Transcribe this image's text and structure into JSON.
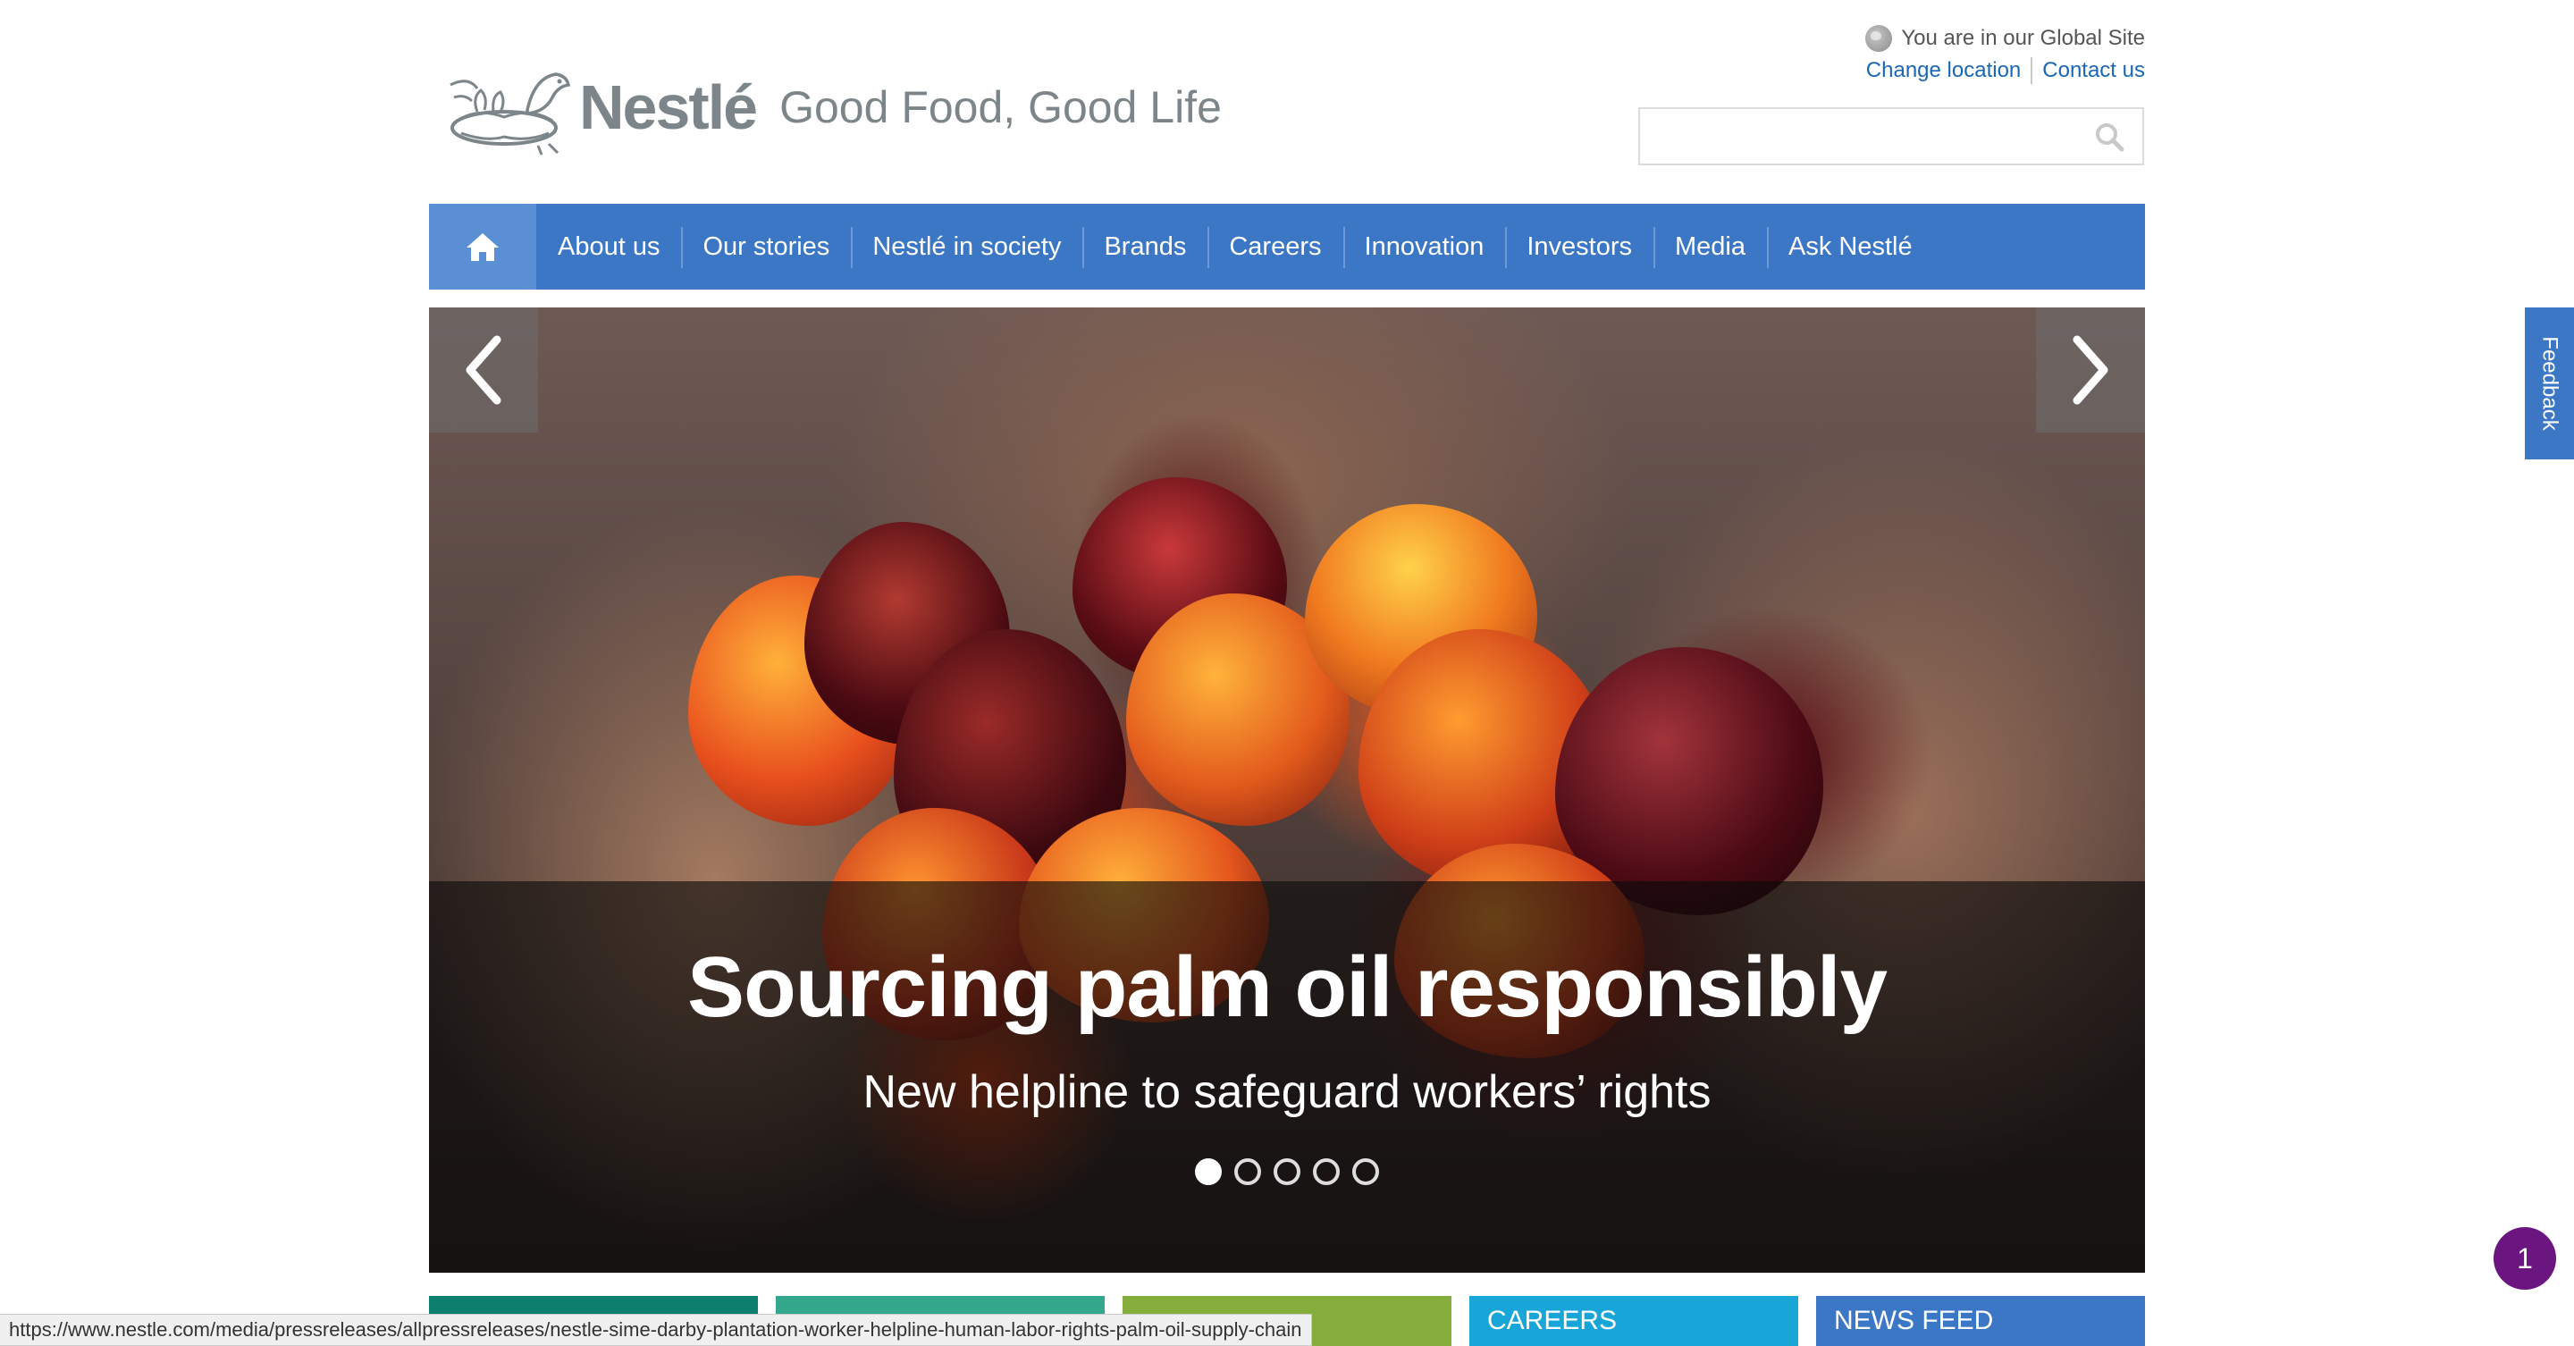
{
  "header": {
    "global_site_text": "You are in our Global Site",
    "change_location": "Change location",
    "contact_us": "Contact us",
    "search_placeholder": ""
  },
  "logo": {
    "wordmark": "Nestlé",
    "tagline": "Good Food, Good Life"
  },
  "nav": {
    "home_icon": "home-icon",
    "items": [
      "About us",
      "Our stories",
      "Nestlé in society",
      "Brands",
      "Careers",
      "Innovation",
      "Investors",
      "Media",
      "Ask Nestlé"
    ]
  },
  "hero": {
    "title": "Sourcing palm oil responsibly",
    "subtitle": "New helpline to safeguard workers’ rights",
    "slide_count": 5,
    "active_slide": 1
  },
  "feedback_label": "Feedback",
  "notification_count": "1",
  "tiles": [
    {
      "label": "",
      "color": "#0c7f6e"
    },
    {
      "label": "",
      "color": "#33a88c"
    },
    {
      "label": "",
      "color": "#84ad3b"
    },
    {
      "label": "CAREERS",
      "color": "#18a6d9"
    },
    {
      "label": "NEWS FEED",
      "color": "#3c77c5"
    }
  ],
  "status_bar_url": "https://www.nestle.com/media/pressreleases/allpressreleases/nestle-sime-darby-plantation-worker-helpline-human-labor-rights-palm-oil-supply-chain",
  "colors": {
    "nav_bg": "#3c77c5",
    "nav_home_bg": "#5b8fd4",
    "link": "#1a67b5",
    "notification": "#6b1580"
  }
}
